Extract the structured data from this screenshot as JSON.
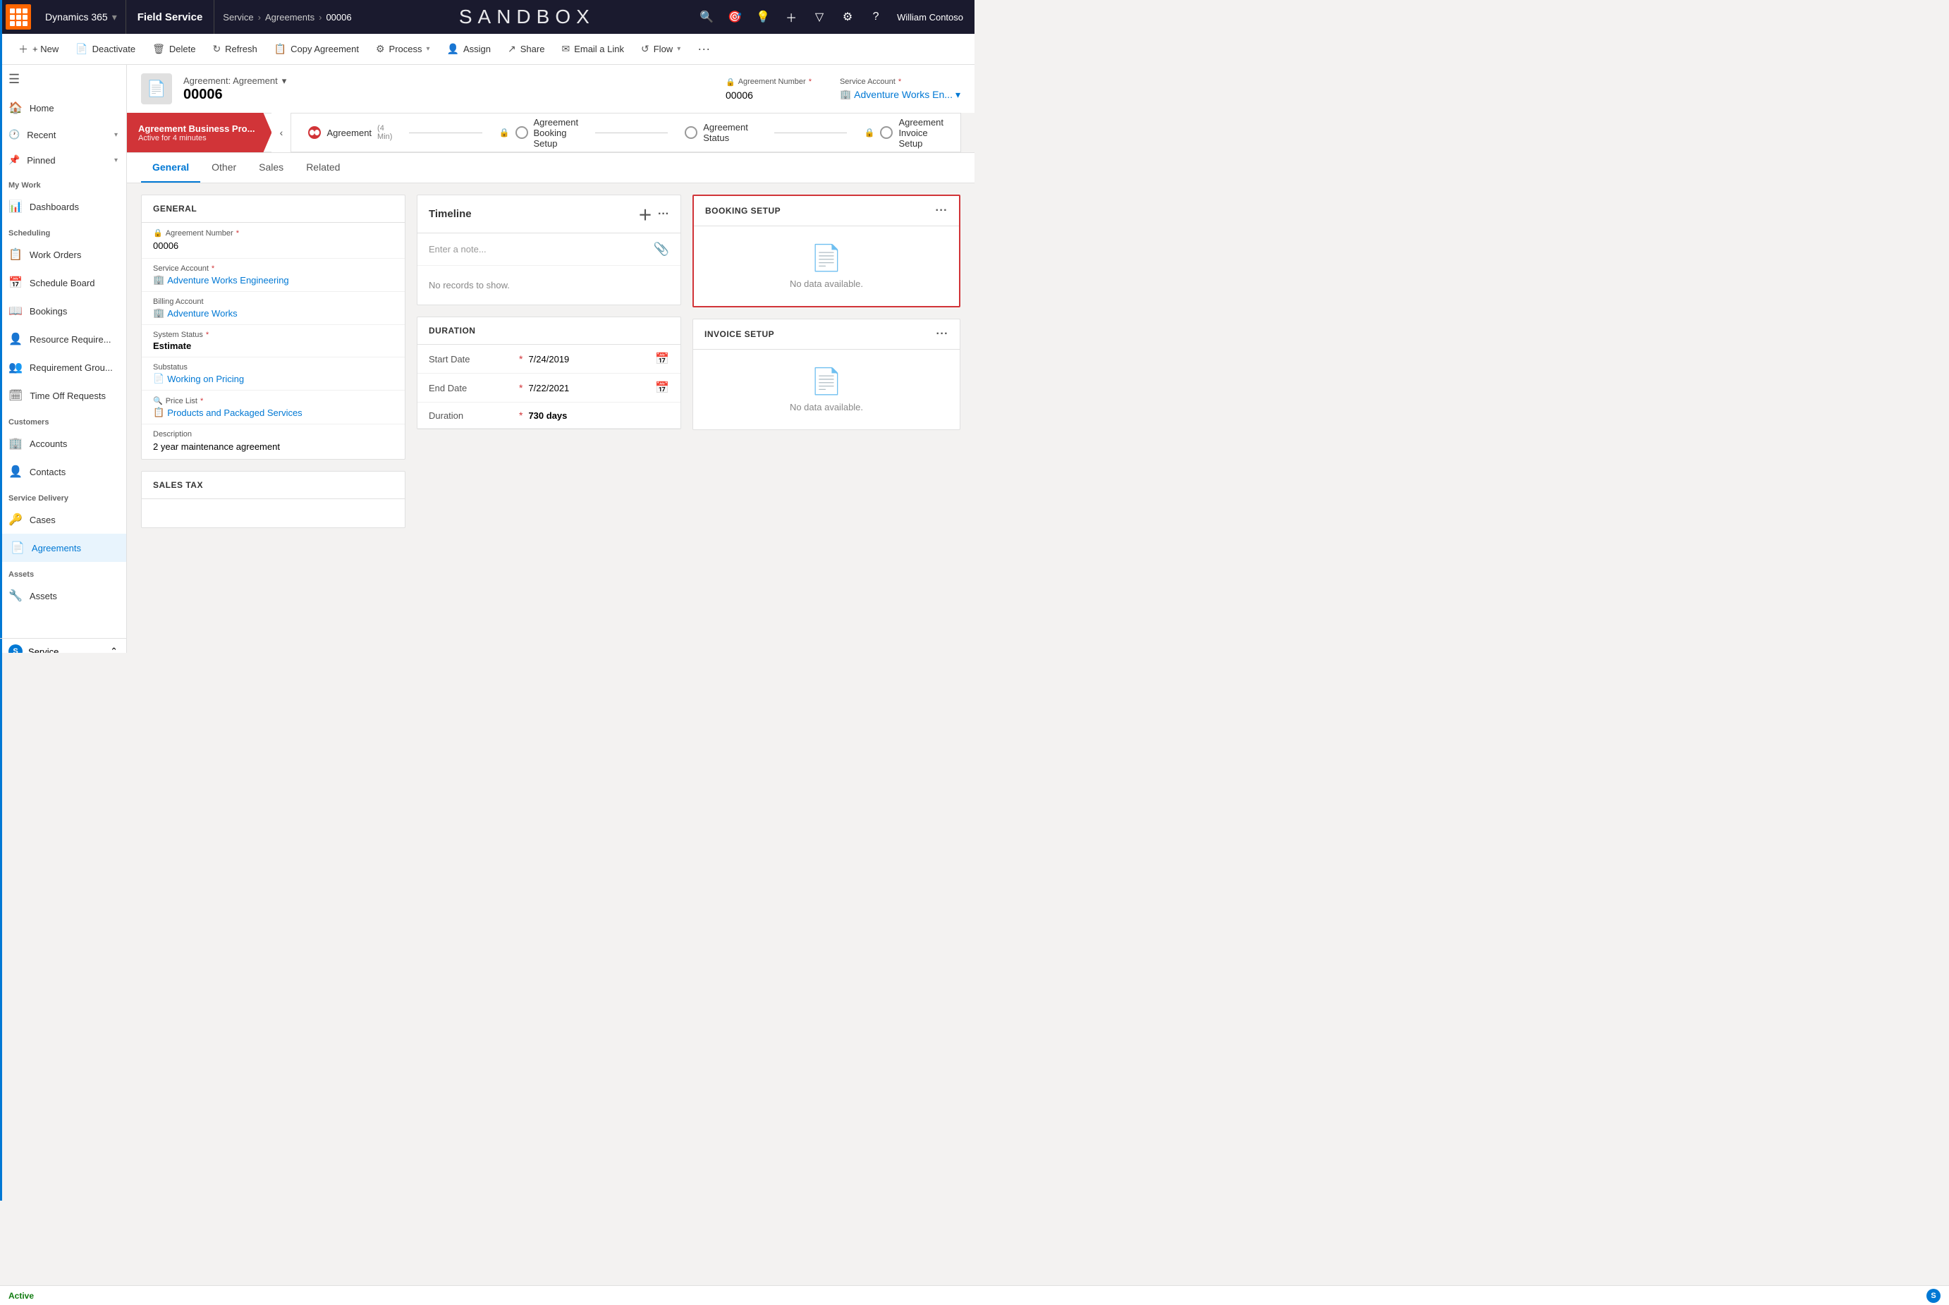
{
  "topnav": {
    "dynamics_label": "Dynamics 365",
    "field_service_label": "Field Service",
    "sandbox_title": "SANDBOX",
    "breadcrumb": [
      "Service",
      "Agreements",
      "00006"
    ],
    "user_name": "William Contoso"
  },
  "commandbar": {
    "new": "+ New",
    "deactivate": "Deactivate",
    "delete": "Delete",
    "refresh": "Refresh",
    "copy_agreement": "Copy Agreement",
    "process": "Process",
    "assign": "Assign",
    "share": "Share",
    "email_a_link": "Email a Link",
    "flow": "Flow"
  },
  "record": {
    "entity": "Agreement: Agreement",
    "name": "00006",
    "agreement_number_label": "Agreement Number",
    "agreement_number": "00006",
    "service_account_label": "Service Account",
    "service_account_value": "Adventure Works En..."
  },
  "process_bar": {
    "active_stage": "Agreement Business Pro...",
    "active_stage_sub": "Active for 4 minutes",
    "stages": [
      {
        "name": "Agreement",
        "sub": "(4 Min)",
        "active": true,
        "locked": false
      },
      {
        "name": "Agreement Booking Setup",
        "active": false,
        "locked": true
      },
      {
        "name": "Agreement Status",
        "active": false,
        "locked": false
      },
      {
        "name": "Agreement Invoice Setup",
        "active": false,
        "locked": true
      }
    ]
  },
  "tabs": [
    "General",
    "Other",
    "Sales",
    "Related"
  ],
  "active_tab": "General",
  "general_panel": {
    "title": "GENERAL",
    "fields": [
      {
        "label": "Agreement Number",
        "value": "00006",
        "required": true,
        "locked": true
      },
      {
        "label": "Service Account",
        "value": "Adventure Works Engineering",
        "required": true,
        "is_link": true
      },
      {
        "label": "Billing Account",
        "value": "Adventure Works",
        "required": false,
        "is_link": true
      },
      {
        "label": "System Status",
        "value": "Estimate",
        "required": true,
        "is_bold": true
      },
      {
        "label": "Substatus",
        "value": "Working on Pricing",
        "required": false,
        "is_link": true
      },
      {
        "label": "Price List",
        "value": "Products and Packaged Services",
        "required": true,
        "is_link": true
      },
      {
        "label": "Description",
        "value": "2 year maintenance agreement",
        "required": false
      }
    ]
  },
  "timeline": {
    "title": "Timeline",
    "placeholder": "Enter a note...",
    "empty_text": "No records to show."
  },
  "duration": {
    "title": "DURATION",
    "fields": [
      {
        "label": "Start Date",
        "value": "7/24/2019",
        "required": true,
        "has_calendar": true
      },
      {
        "label": "End Date",
        "value": "7/22/2021",
        "required": true,
        "has_calendar": true
      },
      {
        "label": "Duration",
        "value": "730 days",
        "required": true,
        "is_bold": true
      }
    ]
  },
  "booking_setup": {
    "title": "BOOKING SETUP",
    "empty_text": "No data available."
  },
  "invoice_setup": {
    "title": "INVOICE SETUP",
    "empty_text": "No data available."
  },
  "sales_tax": {
    "title": "SALES TAX"
  },
  "sidebar": {
    "items": [
      {
        "label": "Home",
        "icon": "🏠",
        "section": null
      },
      {
        "label": "Recent",
        "icon": "🕐",
        "section": null,
        "expandable": true
      },
      {
        "label": "Pinned",
        "icon": "📌",
        "section": null,
        "expandable": true
      },
      {
        "label": "Dashboards",
        "icon": "📊",
        "section": "My Work"
      },
      {
        "label": "Work Orders",
        "icon": "📋",
        "section": "Scheduling"
      },
      {
        "label": "Schedule Board",
        "icon": "📅",
        "section": null
      },
      {
        "label": "Bookings",
        "icon": "📖",
        "section": null
      },
      {
        "label": "Resource Require...",
        "icon": "👤",
        "section": null
      },
      {
        "label": "Requirement Grou...",
        "icon": "👥",
        "section": null
      },
      {
        "label": "Time Off Requests",
        "icon": "🗓",
        "section": null
      },
      {
        "label": "Accounts",
        "icon": "🏢",
        "section": "Customers"
      },
      {
        "label": "Contacts",
        "icon": "👤",
        "section": null
      },
      {
        "label": "Cases",
        "icon": "🔑",
        "section": "Service Delivery"
      },
      {
        "label": "Agreements",
        "icon": "📄",
        "section": null,
        "active": true
      },
      {
        "label": "Assets",
        "icon": "🔧",
        "section": "Assets"
      },
      {
        "label": "Service",
        "icon": "S",
        "section": null,
        "bottom": true
      }
    ]
  },
  "status_bar": {
    "status": "Active"
  }
}
